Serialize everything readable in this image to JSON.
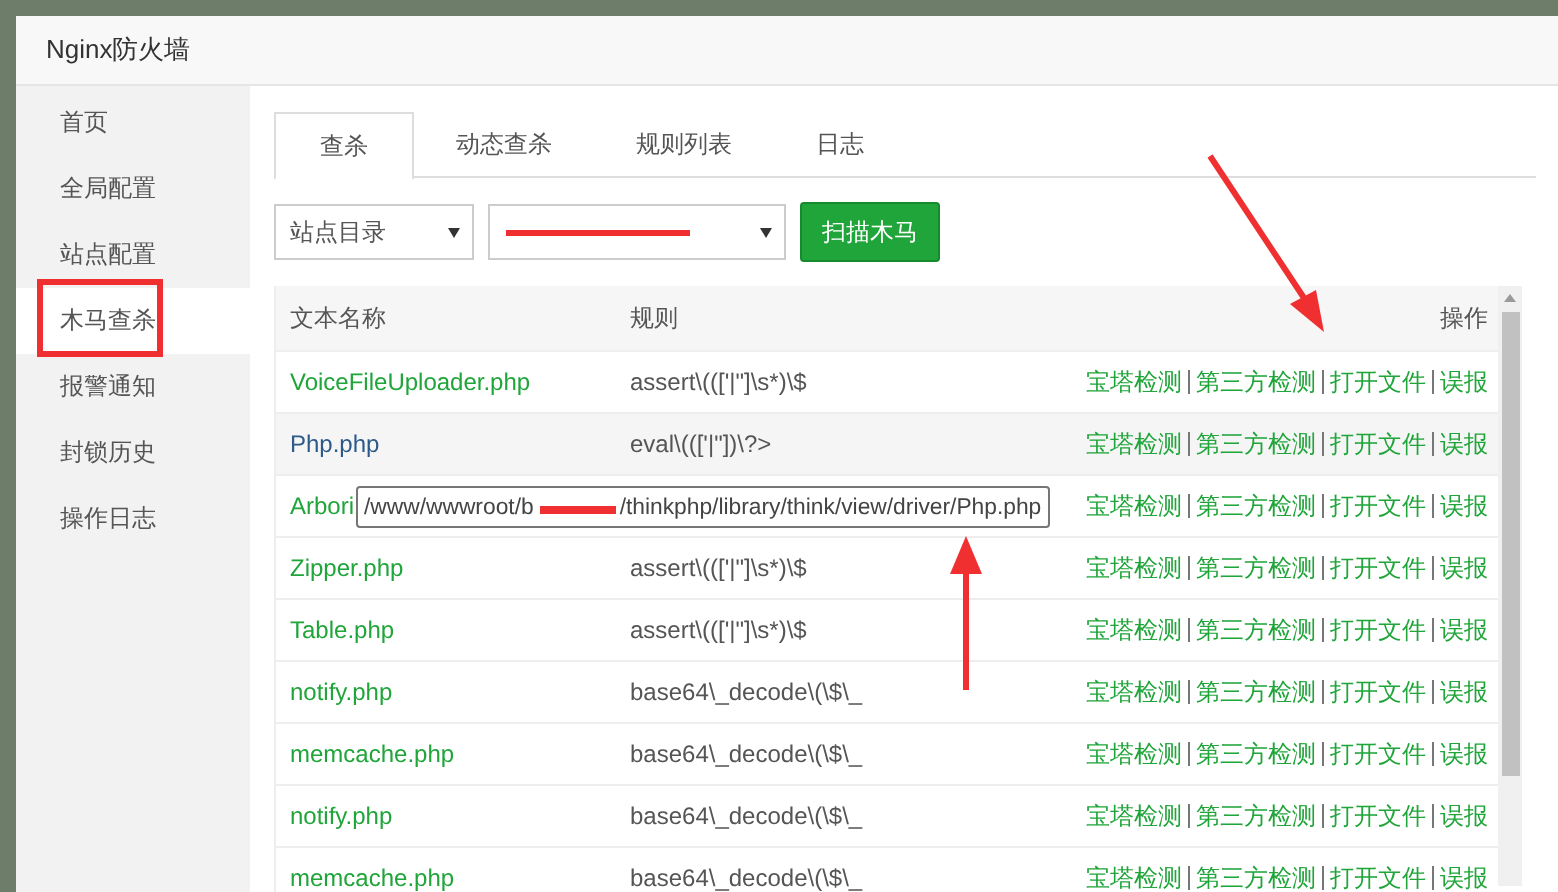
{
  "window": {
    "title": "Nginx防火墙"
  },
  "sidebar": {
    "items": [
      {
        "label": "首页",
        "selected": false
      },
      {
        "label": "全局配置",
        "selected": false
      },
      {
        "label": "站点配置",
        "selected": false
      },
      {
        "label": "木马查杀",
        "selected": true
      },
      {
        "label": "报警通知",
        "selected": false
      },
      {
        "label": "封锁历史",
        "selected": false
      },
      {
        "label": "操作日志",
        "selected": false
      }
    ]
  },
  "tabs": [
    {
      "label": "查杀",
      "selected": true
    },
    {
      "label": "动态查杀",
      "selected": false
    },
    {
      "label": "规则列表",
      "selected": false
    },
    {
      "label": "日志",
      "selected": false
    }
  ],
  "toolbar": {
    "directory_select": "站点目录",
    "scan_button": "扫描木马"
  },
  "table": {
    "columns": [
      "文本名称",
      "规则",
      "操作"
    ],
    "rows": [
      {
        "name": "VoiceFileUploader.php",
        "rule": "assert\\((['|\"]\\s*)\\$",
        "hovered": false,
        "actions": [
          "宝塔检测",
          "第三方检测",
          "打开文件",
          "误报"
        ]
      },
      {
        "name": "Php.php",
        "rule": "eval\\((['|\"])\\?>",
        "hovered": true,
        "actions": [
          "宝塔检测",
          "第三方检测",
          "打开文件",
          "误报"
        ]
      },
      {
        "name": "Arbori",
        "actions": [
          "宝塔检测",
          "第三方检测",
          "打开文件",
          "误报"
        ],
        "hovered": false
      },
      {
        "name": "Zipper.php",
        "rule": "assert\\((['|\"]\\s*)\\$",
        "hovered": false,
        "actions": [
          "宝塔检测",
          "第三方检测",
          "打开文件",
          "误报"
        ]
      },
      {
        "name": "Table.php",
        "rule": "assert\\((['|\"]\\s*)\\$",
        "hovered": false,
        "actions": [
          "宝塔检测",
          "第三方检测",
          "打开文件",
          "误报"
        ]
      },
      {
        "name": "notify.php",
        "rule": "base64\\_decode\\(\\$\\_",
        "hovered": false,
        "actions": [
          "宝塔检测",
          "第三方检测",
          "打开文件",
          "误报"
        ]
      },
      {
        "name": "memcache.php",
        "rule": "base64\\_decode\\(\\$\\_",
        "hovered": false,
        "actions": [
          "宝塔检测",
          "第三方检测",
          "打开文件",
          "误报"
        ]
      },
      {
        "name": "notify.php",
        "rule": "base64\\_decode\\(\\$\\_",
        "hovered": false,
        "actions": [
          "宝塔检测",
          "第三方检测",
          "打开文件",
          "误报"
        ]
      },
      {
        "name": "memcache.php",
        "rule": "base64\\_decode\\(\\$\\_",
        "hovered": false,
        "actions": [
          "宝塔检测",
          "第三方检测",
          "打开文件",
          "误报"
        ]
      }
    ]
  },
  "tooltip": {
    "path_start": "/www/wwwroot/b",
    "path_end": "/thinkphp/library/think/view/driver/Php.php"
  }
}
